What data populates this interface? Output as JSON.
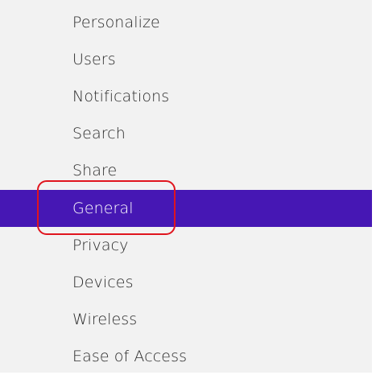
{
  "theme": {
    "accent": "#4617b4",
    "ring": "#e0141e"
  },
  "settings_menu": {
    "items": [
      {
        "label": "Personalize",
        "selected": false
      },
      {
        "label": "Users",
        "selected": false
      },
      {
        "label": "Notifications",
        "selected": false
      },
      {
        "label": "Search",
        "selected": false
      },
      {
        "label": "Share",
        "selected": false
      },
      {
        "label": "General",
        "selected": true
      },
      {
        "label": "Privacy",
        "selected": false
      },
      {
        "label": "Devices",
        "selected": false
      },
      {
        "label": "Wireless",
        "selected": false
      },
      {
        "label": "Ease of Access",
        "selected": false
      }
    ]
  }
}
